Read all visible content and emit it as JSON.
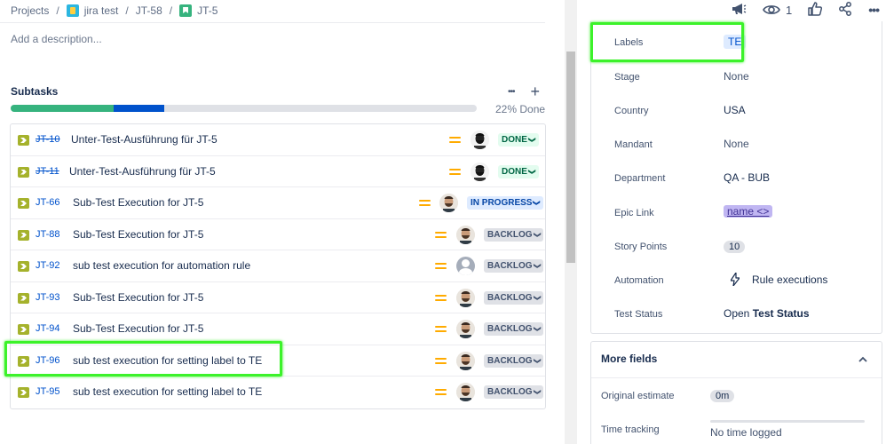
{
  "breadcrumb": {
    "projects": "Projects",
    "project": "jira test",
    "parent": "JT-58",
    "issue": "JT-5",
    "separator": "/"
  },
  "description": {
    "placeholder": "Add a description..."
  },
  "subtasks": {
    "title": "Subtasks",
    "more_label": "•••",
    "add_label": "+",
    "percent_done": "22% Done",
    "progress": {
      "done_fraction": 0.22,
      "in_progress_fraction": 0.11,
      "colors": {
        "done": "#36b37e",
        "in_progress": "#0052cc",
        "todo": "#dfe1e6"
      }
    },
    "items": [
      {
        "key": "JT-10",
        "summary": "Unter-Test-Ausführung für JT-5",
        "status": "DONE",
        "status_type": "done",
        "key_done": true,
        "avatar": "photo-dark"
      },
      {
        "key": "JT-11",
        "summary": "Unter-Test-Ausführung für JT-5",
        "status": "DONE",
        "status_type": "done",
        "key_done": true,
        "avatar": "photo-dark"
      },
      {
        "key": "JT-66",
        "summary": "Sub-Test Execution for JT-5",
        "status": "IN PROGRESS",
        "status_type": "inprogress",
        "key_done": false,
        "avatar": "photo-beard"
      },
      {
        "key": "JT-88",
        "summary": "Sub-Test Execution for JT-5",
        "status": "BACKLOG",
        "status_type": "backlog",
        "key_done": false,
        "avatar": "photo-beard"
      },
      {
        "key": "JT-92",
        "summary": "sub test execution for automation rule",
        "status": "BACKLOG",
        "status_type": "backlog",
        "key_done": false,
        "avatar": "generic"
      },
      {
        "key": "JT-93",
        "summary": "Sub-Test Execution for JT-5",
        "status": "BACKLOG",
        "status_type": "backlog",
        "key_done": false,
        "avatar": "photo-beard"
      },
      {
        "key": "JT-94",
        "summary": "Sub-Test Execution for JT-5",
        "status": "BACKLOG",
        "status_type": "backlog",
        "key_done": false,
        "avatar": "photo-beard"
      },
      {
        "key": "JT-96",
        "summary": "sub test execution for setting label to TE",
        "status": "BACKLOG",
        "status_type": "backlog",
        "key_done": false,
        "avatar": "photo-beard"
      },
      {
        "key": "JT-95",
        "summary": "sub test execution for setting label to TE",
        "status": "BACKLOG",
        "status_type": "backlog",
        "key_done": false,
        "avatar": "photo-beard"
      }
    ]
  },
  "toolbar": {
    "watch_count": "1"
  },
  "details": {
    "labels": {
      "label": "Labels",
      "value": "TE"
    },
    "stage": {
      "label": "Stage",
      "value": "None"
    },
    "country": {
      "label": "Country",
      "value": "USA"
    },
    "mandant": {
      "label": "Mandant",
      "value": "None"
    },
    "department": {
      "label": "Department",
      "value": "QA - BUB"
    },
    "epic_link": {
      "label": "Epic Link",
      "value": "name <>"
    },
    "story_points": {
      "label": "Story Points",
      "value": "10"
    },
    "automation": {
      "label": "Automation",
      "value": "Rule executions"
    },
    "test_status": {
      "label": "Test Status",
      "value_prefix": "Open",
      "value_bold": "Test Status"
    }
  },
  "more_fields": {
    "title": "More fields",
    "original_estimate": {
      "label": "Original estimate",
      "value": "0m"
    },
    "time_tracking": {
      "label": "Time tracking",
      "value": "No time logged"
    }
  },
  "colors": {
    "highlight": "#3cf22a",
    "accent": "#0052cc",
    "priority_medium": "#ffab00"
  }
}
